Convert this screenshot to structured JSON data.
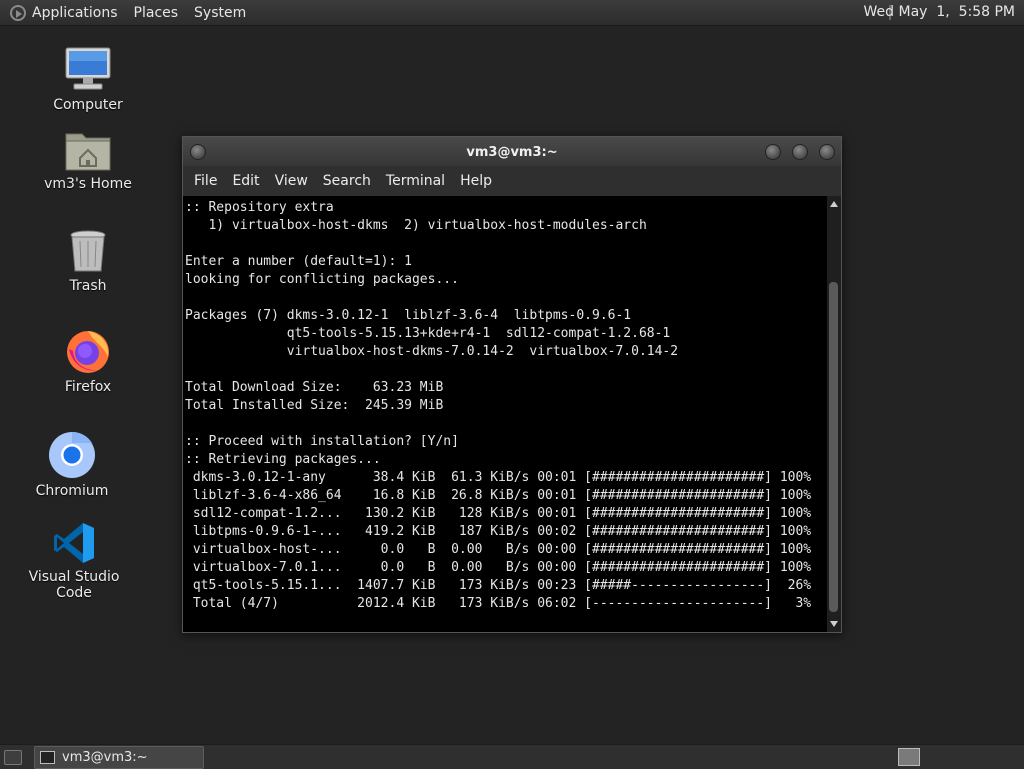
{
  "top_panel": {
    "menus": [
      "Applications",
      "Places",
      "System"
    ],
    "clock": "Wed May  1,  5:58 PM"
  },
  "desktop_icons": [
    {
      "label": "Computer",
      "icon": "computer-icon"
    },
    {
      "label": "vm3's Home",
      "icon": "home-folder-icon"
    },
    {
      "label": "Trash",
      "icon": "trash-icon"
    },
    {
      "label": "Firefox",
      "icon": "firefox-icon"
    },
    {
      "label": "Chromium",
      "icon": "chromium-icon"
    },
    {
      "label": "Visual Studio Code",
      "icon": "vscode-icon"
    }
  ],
  "window": {
    "title": "vm3@vm3:~",
    "menu": [
      "File",
      "Edit",
      "View",
      "Search",
      "Terminal",
      "Help"
    ],
    "terminal_text": ":: Repository extra\n   1) virtualbox-host-dkms  2) virtualbox-host-modules-arch\n\nEnter a number (default=1): 1\nlooking for conflicting packages...\n\nPackages (7) dkms-3.0.12-1  liblzf-3.6-4  libtpms-0.9.6-1\n             qt5-tools-5.15.13+kde+r4-1  sdl12-compat-1.2.68-1\n             virtualbox-host-dkms-7.0.14-2  virtualbox-7.0.14-2\n\nTotal Download Size:    63.23 MiB\nTotal Installed Size:  245.39 MiB\n\n:: Proceed with installation? [Y/n]\n:: Retrieving packages...\n dkms-3.0.12-1-any      38.4 KiB  61.3 KiB/s 00:01 [######################] 100%\n liblzf-3.6-4-x86_64    16.8 KiB  26.8 KiB/s 00:01 [######################] 100%\n sdl12-compat-1.2...   130.2 KiB   128 KiB/s 00:01 [######################] 100%\n libtpms-0.9.6-1-...   419.2 KiB   187 KiB/s 00:02 [######################] 100%\n virtualbox-host-...     0.0   B  0.00   B/s 00:00 [######################] 100%\n virtualbox-7.0.1...     0.0   B  0.00   B/s 00:00 [######################] 100%\n qt5-tools-5.15.1...  1407.7 KiB   173 KiB/s 00:23 [#####-----------------]  26%\n Total (4/7)          2012.4 KiB   173 KiB/s 06:02 [----------------------]   3%"
  },
  "bottom_panel": {
    "task_label": "vm3@vm3:~"
  },
  "colors": {
    "desktop": "#232323",
    "panel": "#2f2f2f",
    "terminal_bg": "#000000",
    "terminal_fg": "#e6e6e6"
  }
}
